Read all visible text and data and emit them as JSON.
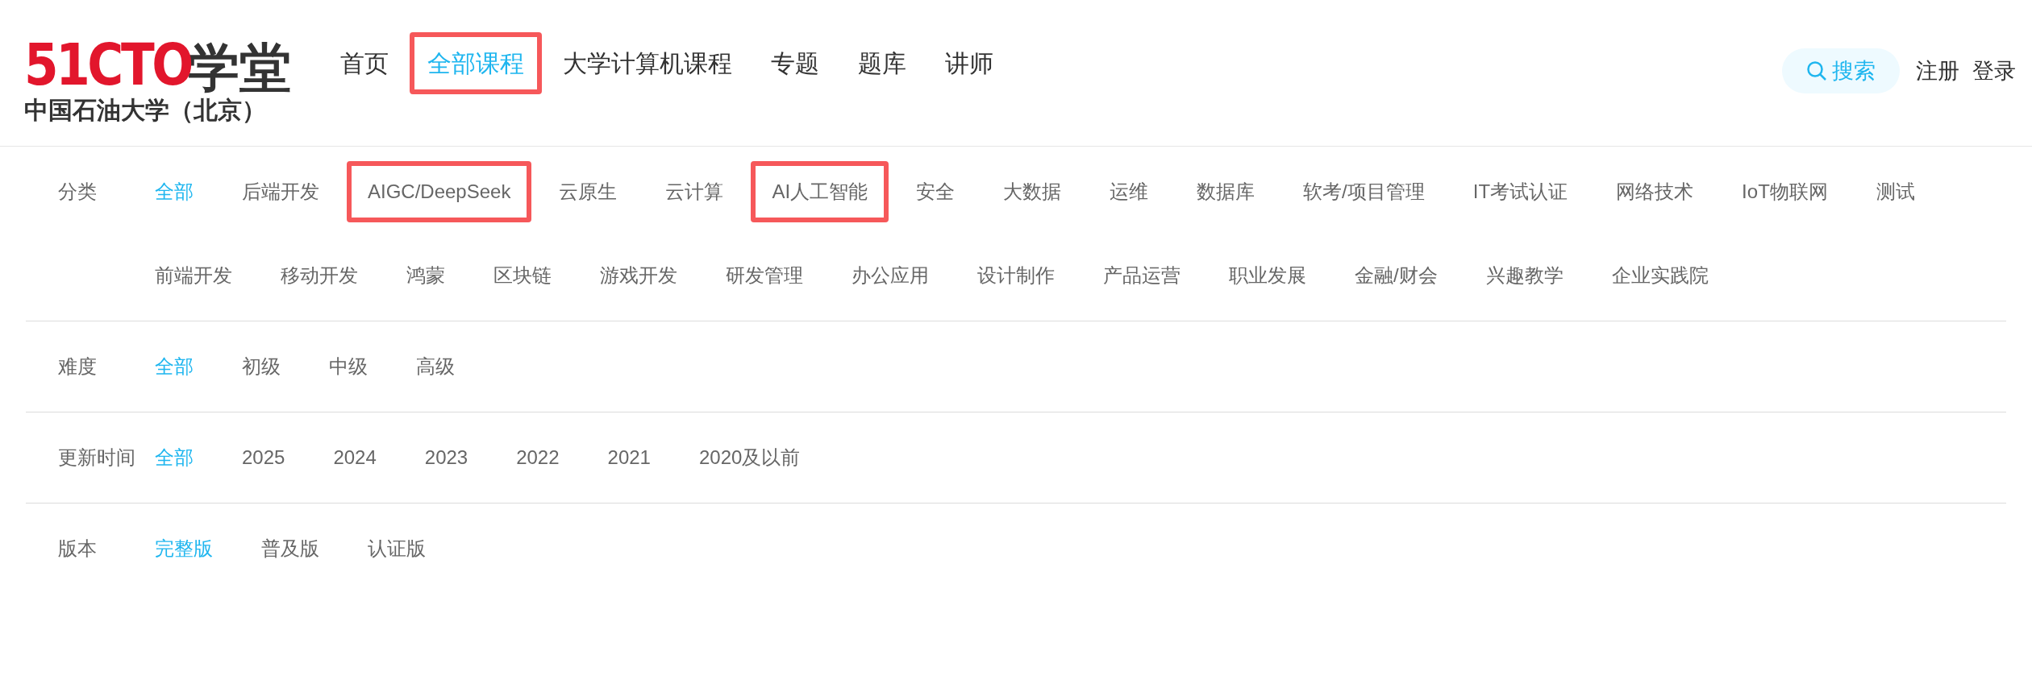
{
  "logo": {
    "brand": "51CTO",
    "suffix": "学堂",
    "school": "中国石油大学（北京）"
  },
  "nav": [
    {
      "label": "首页",
      "selected": false,
      "highlighted": false
    },
    {
      "label": "全部课程",
      "selected": true,
      "highlighted": true
    },
    {
      "label": "大学计算机课程",
      "selected": false,
      "highlighted": false
    },
    {
      "label": "专题",
      "selected": false,
      "highlighted": false
    },
    {
      "label": "题库",
      "selected": false,
      "highlighted": false
    },
    {
      "label": "讲师",
      "selected": false,
      "highlighted": false
    }
  ],
  "search": {
    "label": "搜索"
  },
  "account": [
    "注册",
    "登录"
  ],
  "filters": [
    {
      "label": "分类",
      "options": [
        {
          "label": "全部",
          "selected": true,
          "highlighted": false
        },
        {
          "label": "后端开发",
          "selected": false,
          "highlighted": false
        },
        {
          "label": "AIGC/DeepSeek",
          "selected": false,
          "highlighted": true
        },
        {
          "label": "云原生",
          "selected": false,
          "highlighted": false
        },
        {
          "label": "云计算",
          "selected": false,
          "highlighted": false
        },
        {
          "label": "AI人工智能",
          "selected": false,
          "highlighted": true
        },
        {
          "label": "安全",
          "selected": false,
          "highlighted": false
        },
        {
          "label": "大数据",
          "selected": false,
          "highlighted": false
        },
        {
          "label": "运维",
          "selected": false,
          "highlighted": false
        },
        {
          "label": "数据库",
          "selected": false,
          "highlighted": false
        },
        {
          "label": "软考/项目管理",
          "selected": false,
          "highlighted": false
        },
        {
          "label": "IT考试认证",
          "selected": false,
          "highlighted": false
        },
        {
          "label": "网络技术",
          "selected": false,
          "highlighted": false
        },
        {
          "label": "IoT物联网",
          "selected": false,
          "highlighted": false
        },
        {
          "label": "测试",
          "selected": false,
          "highlighted": false
        },
        {
          "label": "前端开发",
          "selected": false,
          "highlighted": false
        },
        {
          "label": "移动开发",
          "selected": false,
          "highlighted": false
        },
        {
          "label": "鸿蒙",
          "selected": false,
          "highlighted": false
        },
        {
          "label": "区块链",
          "selected": false,
          "highlighted": false
        },
        {
          "label": "游戏开发",
          "selected": false,
          "highlighted": false
        },
        {
          "label": "研发管理",
          "selected": false,
          "highlighted": false
        },
        {
          "label": "办公应用",
          "selected": false,
          "highlighted": false
        },
        {
          "label": "设计制作",
          "selected": false,
          "highlighted": false
        },
        {
          "label": "产品运营",
          "selected": false,
          "highlighted": false
        },
        {
          "label": "职业发展",
          "selected": false,
          "highlighted": false
        },
        {
          "label": "金融/财会",
          "selected": false,
          "highlighted": false
        },
        {
          "label": "兴趣教学",
          "selected": false,
          "highlighted": false
        },
        {
          "label": "企业实践院",
          "selected": false,
          "highlighted": false
        }
      ]
    },
    {
      "label": "难度",
      "options": [
        {
          "label": "全部",
          "selected": true,
          "highlighted": false
        },
        {
          "label": "初级",
          "selected": false,
          "highlighted": false
        },
        {
          "label": "中级",
          "selected": false,
          "highlighted": false
        },
        {
          "label": "高级",
          "selected": false,
          "highlighted": false
        }
      ]
    },
    {
      "label": "更新时间",
      "options": [
        {
          "label": "全部",
          "selected": true,
          "highlighted": false
        },
        {
          "label": "2025",
          "selected": false,
          "highlighted": false
        },
        {
          "label": "2024",
          "selected": false,
          "highlighted": false
        },
        {
          "label": "2023",
          "selected": false,
          "highlighted": false
        },
        {
          "label": "2022",
          "selected": false,
          "highlighted": false
        },
        {
          "label": "2021",
          "selected": false,
          "highlighted": false
        },
        {
          "label": "2020及以前",
          "selected": false,
          "highlighted": false
        }
      ]
    },
    {
      "label": "版本",
      "options": [
        {
          "label": "完整版",
          "selected": true,
          "highlighted": false
        },
        {
          "label": "普及版",
          "selected": false,
          "highlighted": false
        },
        {
          "label": "认证版",
          "selected": false,
          "highlighted": false
        }
      ]
    }
  ]
}
